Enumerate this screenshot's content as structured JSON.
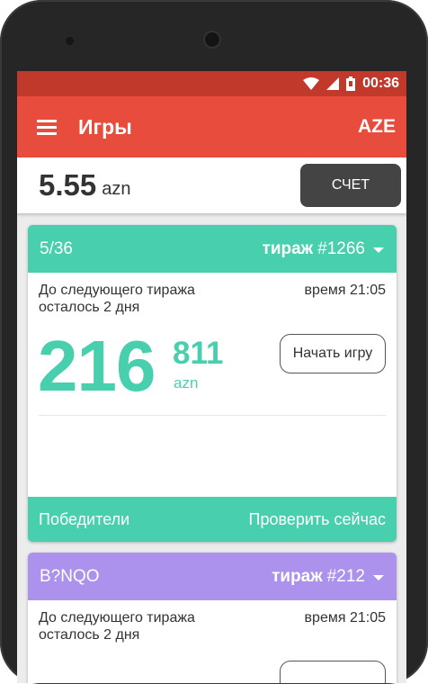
{
  "status_bar": {
    "time": "00:36"
  },
  "app_bar": {
    "title": "Игры",
    "currency": "AZE"
  },
  "balance": {
    "amount": "5.55",
    "currency": "azn",
    "account_button": "СЧЕТ"
  },
  "games": [
    {
      "name": "5/36",
      "draw_label": "тираж",
      "draw_number": "#1266",
      "next_draw_text": "До следующего тиража осталось 2 дня",
      "draw_time": "время 21:05",
      "jackpot_main": "216",
      "jackpot_small": "811",
      "jackpot_currency": "azn",
      "play_button": "Начать игру",
      "footer_left": "Победители",
      "footer_right": "Проверить сейчас",
      "color": "#48cfad"
    },
    {
      "name": "B?NQO",
      "draw_label": "тираж",
      "draw_number": "#212",
      "next_draw_text": "До следующего тиража осталось 2 дня",
      "draw_time": "время 21:05",
      "color": "#ac92ec"
    }
  ],
  "colors": {
    "status_bar": "#c0392b",
    "app_bar": "#e74c3c",
    "accent_green": "#48cfad",
    "accent_purple": "#ac92ec"
  }
}
